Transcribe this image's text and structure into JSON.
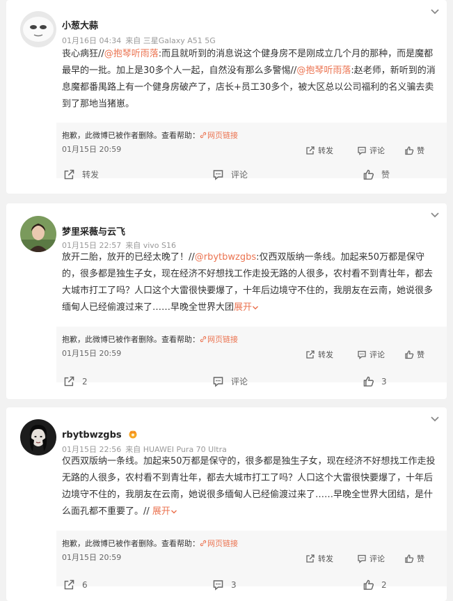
{
  "posts": [
    {
      "user": "小葱大蒜",
      "date": "01月16日 04:34",
      "via": "来自 三星Galaxy A51 5G",
      "text_a": "丧心病狂//",
      "mention_a": "@抱琴听雨落",
      "text_b": ":而且就听到的消息说这个健身房不是刚成立几个月的那种，而是魔都最早的一批。加上是30多个人一起，自然没有那么多警惕//",
      "mention_b": "@抱琴听雨落",
      "text_c": ":赵老师，新听到的消息魔都番禺路上有一个健身房破产了，店长+员工30多个，被大区总以公司福利的名义骗去卖到了那地当猪崽。",
      "expand": "",
      "repost": {
        "notice": "抱歉，此微博已被作者删除。查看帮助：",
        "link": "网页链接",
        "date": "01月15日 20:59",
        "repost_label": "转发",
        "comment_label": "评论",
        "like_label": "赞"
      },
      "actions": {
        "repost": "转发",
        "comment": "评论",
        "like": "赞"
      }
    },
    {
      "user": "梦里采薇与云飞",
      "date": "01月15日 22:57",
      "via": "来自 vivo S16",
      "text_a": "放开二胎，放开的已经太晚了！//",
      "mention_a": "@rbytbwzgbs",
      "text_b": ":仅西双版纳一条线。加起来50万都是保守的，很多都是独生子女，现在经济不好想找工作走投无路的人很多，农村看不到青壮年，都去大城市打工了吗？人口这个大雷很快要爆了，十年后边境守不住的，我朋友在云南，她说很多缅甸人已经偷渡过来了……早晚全世界大团",
      "mention_b": "",
      "text_c": "",
      "expand": "展开",
      "repost": {
        "notice": "抱歉，此微博已被作者删除。查看帮助：",
        "link": "网页链接",
        "date": "01月15日 20:59",
        "repost_label": "转发",
        "comment_label": "评论",
        "like_label": "赞"
      },
      "actions": {
        "repost": "2",
        "comment": "评论",
        "like": "3"
      }
    },
    {
      "user": "rbytbwzgbs",
      "date": "01月15日 22:56",
      "via": "来自 HUAWEI Pura 70 Ultra",
      "text_a": "仅西双版纳一条线。加起来50万都是保守的，很多都是独生子女，现在经济不好想找工作走投无路的人很多，农村看不到青壮年，都去大城市打工了吗？人口这个大雷很快要爆了，十年后边境守不住的，我朋友在云南，她说很多缅甸人已经偷渡过来了……早晚全世界大团结，是什么面孔都不重要了。// ",
      "mention_a": "",
      "text_b": "",
      "mention_b": "",
      "text_c": "",
      "expand": "展开",
      "repost": {
        "notice": "抱歉，此微博已被作者删除。查看帮助：",
        "link": "网页链接",
        "date": "01月15日 20:59",
        "repost_label": "转发",
        "comment_label": "评论",
        "like_label": "赞"
      },
      "actions": {
        "repost": "6",
        "comment": "3",
        "like": "2"
      }
    }
  ],
  "icons": {
    "more": "chevron-down-icon",
    "repost": "share-icon",
    "comment": "comment-icon",
    "like": "thumbs-up-icon",
    "link": "link-icon",
    "vip": "crown-badge-icon"
  },
  "colors": {
    "link": "#eb7350",
    "bg": "#f2f2f2",
    "repost_bg": "#f7f7f7"
  }
}
